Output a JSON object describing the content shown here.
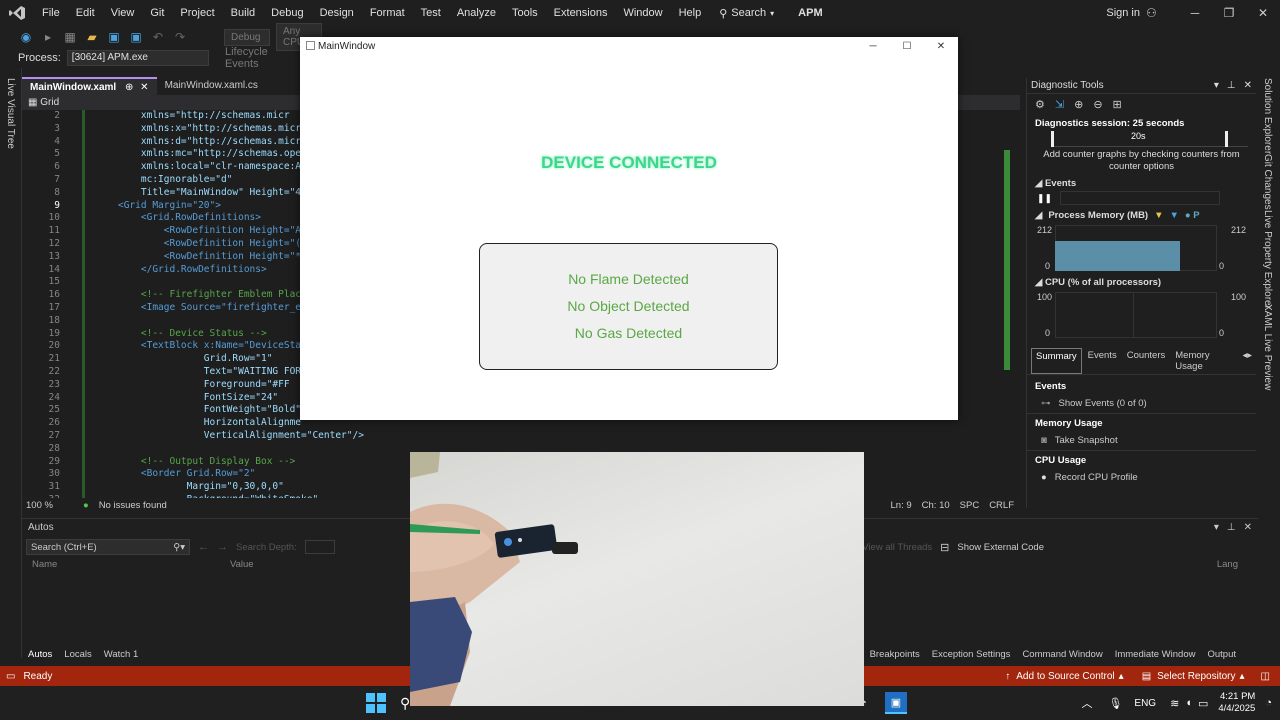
{
  "menubar": {
    "items": [
      "File",
      "Edit",
      "View",
      "Git",
      "Project",
      "Build",
      "Debug",
      "Design",
      "Format",
      "Test",
      "Analyze",
      "Tools",
      "Extensions",
      "Window",
      "Help"
    ],
    "search_label": "Search",
    "app_name": "APM",
    "sign_in": "Sign in"
  },
  "toolbar": {
    "debug_dropdown": "Debug",
    "cpu_dropdown": "Any CPU"
  },
  "process": {
    "label": "Process:",
    "value": "[30624] APM.exe",
    "lifecycle": "Lifecycle Events"
  },
  "left_strip": {
    "label": "Live Visual Tree"
  },
  "tabs": [
    {
      "label": "MainWindow.xaml",
      "active": true
    },
    {
      "label": "MainWindow.xaml.cs",
      "active": false
    }
  ],
  "navbar": {
    "scope": "Grid"
  },
  "code_lines": [
    {
      "n": "2",
      "t": "    xmlns=\"http://schemas.micr"
    },
    {
      "n": "3",
      "t": "    xmlns:x=\"http://schemas.micr"
    },
    {
      "n": "4",
      "t": "    xmlns:d=\"http://schemas.micr"
    },
    {
      "n": "5",
      "t": "    xmlns:mc=\"http://schemas.ope"
    },
    {
      "n": "6",
      "t": "    xmlns:local=\"clr-namespace:A"
    },
    {
      "n": "7",
      "t": "    mc:Ignorable=\"d\""
    },
    {
      "n": "8",
      "t": "    Title=\"MainWindow\" Height=\"4"
    },
    {
      "n": "9",
      "t": "<Grid Margin=\"20\">"
    },
    {
      "n": "10",
      "t": "    <Grid.RowDefinitions>"
    },
    {
      "n": "11",
      "t": "        <RowDefinition Height=\"A"
    },
    {
      "n": "12",
      "t": "        <RowDefinition Height=\"("
    },
    {
      "n": "13",
      "t": "        <RowDefinition Height=\"*"
    },
    {
      "n": "14",
      "t": "    </Grid.RowDefinitions>"
    },
    {
      "n": "15",
      "t": ""
    },
    {
      "n": "16",
      "t": "    <!-- Firefighter Emblem Plac"
    },
    {
      "n": "17",
      "t": "    <Image Source=\"firefighter_e"
    },
    {
      "n": "18",
      "t": ""
    },
    {
      "n": "19",
      "t": "    <!-- Device Status -->"
    },
    {
      "n": "20",
      "t": "    <TextBlock x:Name=\"DeviceSta"
    },
    {
      "n": "21",
      "t": "               Grid.Row=\"1\""
    },
    {
      "n": "22",
      "t": "               Text=\"WAITING FOR"
    },
    {
      "n": "23",
      "t": "               Foreground=\"#FF"
    },
    {
      "n": "24",
      "t": "               FontSize=\"24\""
    },
    {
      "n": "25",
      "t": "               FontWeight=\"Bold\""
    },
    {
      "n": "26",
      "t": "               HorizontalAlignme"
    },
    {
      "n": "27",
      "t": "               VerticalAlignment=\"Center\"/>"
    },
    {
      "n": "28",
      "t": ""
    },
    {
      "n": "29",
      "t": "    <!-- Output Display Box -->"
    },
    {
      "n": "30",
      "t": "    <Border Grid.Row=\"2\""
    },
    {
      "n": "31",
      "t": "            Margin=\"0,30,0,0\""
    },
    {
      "n": "32",
      "t": "            Background=\"WhiteSmoke\""
    }
  ],
  "editor_status": {
    "zoom": "100 %",
    "issues": "No issues found",
    "ln": "Ln: 9",
    "ch": "Ch: 10",
    "spc": "SPC",
    "crlf": "CRLF"
  },
  "mainwindow": {
    "title": "MainWindow",
    "status": "DEVICE CONNECTED",
    "lines": [
      "No Flame Detected",
      "No Object Detected",
      "No Gas Detected"
    ]
  },
  "diagnostics": {
    "title": "Diagnostic Tools",
    "session": "Diagnostics session: 25 seconds",
    "timeline_tick": "20s",
    "hint": "Add counter graphs by checking counters from counter options",
    "events_label": "Events",
    "memory_label": "Process Memory (MB)",
    "memory_max": "212",
    "memory_min": "0",
    "cpu_label": "CPU (% of all processors)",
    "cpu_max": "100",
    "cpu_min": "0",
    "tabs": [
      "Summary",
      "Events",
      "Counters",
      "Memory Usage"
    ],
    "sections": [
      {
        "heading": "Events",
        "action": "Show Events (0 of 0)"
      },
      {
        "heading": "Memory Usage",
        "action": "Take Snapshot"
      },
      {
        "heading": "CPU Usage",
        "action": "Record CPU Profile"
      }
    ]
  },
  "right_strip": [
    "Solution Explorer",
    "Git Changes",
    "Live Property Explorer",
    "XAML Live Preview"
  ],
  "autos": {
    "title": "Autos",
    "search_placeholder": "Search (Ctrl+E)",
    "depth": "Search Depth:",
    "col_name": "Name",
    "col_value": "Value",
    "col_lang": "Lang",
    "view_threads": "View all Threads",
    "show_external": "Show External Code"
  },
  "bottom_tabs_left": [
    "Autos",
    "Locals",
    "Watch 1"
  ],
  "bottom_tabs_right": [
    "Breakpoints",
    "Exception Settings",
    "Command Window",
    "Immediate Window",
    "Output"
  ],
  "statusbar": {
    "ready": "Ready",
    "source_control": "Add to Source Control",
    "repository": "Select Repository"
  },
  "taskbar": {
    "lang": "ENG",
    "time": "4:21 PM",
    "date": "4/4/2025"
  },
  "colors": {
    "accent": "#b48ef0",
    "status_green": "#3dd68c",
    "detect_green": "#5aa845",
    "statusbar": "#a1260d"
  }
}
